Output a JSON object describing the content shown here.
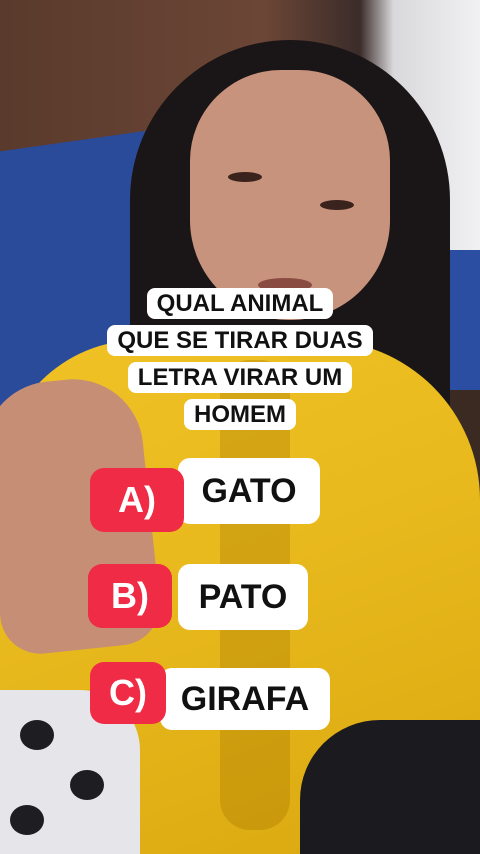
{
  "question": {
    "lines": [
      "QUAL ANIMAL",
      "QUE SE TIRAR DUAS",
      "LETRA VIRAR UM",
      "HOMEM"
    ]
  },
  "options": [
    {
      "letter": "A)",
      "text": "GATO"
    },
    {
      "letter": "B)",
      "text": "PATO"
    },
    {
      "letter": "C)",
      "text": "GIRAFA"
    }
  ],
  "colors": {
    "option_letter_bg": "#ef2b45",
    "label_bg": "#ffffff",
    "label_text": "#111111"
  }
}
